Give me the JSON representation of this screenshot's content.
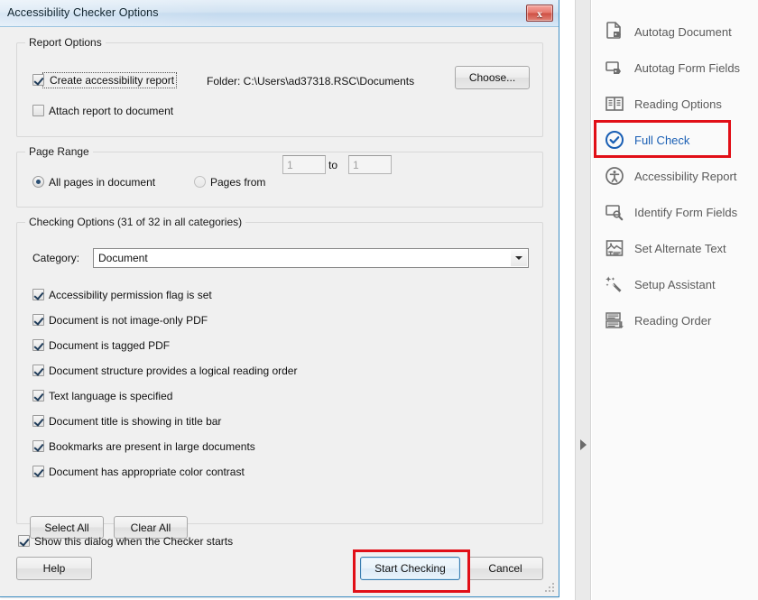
{
  "dialog": {
    "title": "Accessibility Checker Options",
    "close_label": "x",
    "report_options": {
      "legend": "Report Options",
      "create_report": {
        "label": "Create accessibility report",
        "checked": true,
        "focused": true
      },
      "folder_text": "Folder: C:\\Users\\ad37318.RSC\\Documents",
      "choose_button": "Choose...",
      "attach_report": {
        "label": "Attach report to document",
        "checked": false
      }
    },
    "page_range": {
      "legend": "Page Range",
      "all_pages": {
        "label": "All pages in document",
        "selected": true
      },
      "pages_from": {
        "label": "Pages from",
        "selected": false
      },
      "from_value": "1",
      "to_label": "to",
      "to_value": "1"
    },
    "checking_options": {
      "legend": "Checking Options (31 of 32 in all categories)",
      "category_label": "Category:",
      "category_value": "Document",
      "category_arrow": "chevron-down-icon",
      "items": [
        {
          "label": "Accessibility permission flag is set",
          "checked": true
        },
        {
          "label": "Document is not image-only PDF",
          "checked": true
        },
        {
          "label": "Document is tagged PDF",
          "checked": true
        },
        {
          "label": "Document structure provides a logical reading order",
          "checked": true
        },
        {
          "label": "Text language is specified",
          "checked": true
        },
        {
          "label": "Document title is showing in title bar",
          "checked": true
        },
        {
          "label": "Bookmarks are present in large documents",
          "checked": true
        },
        {
          "label": "Document has appropriate color contrast",
          "checked": true
        }
      ],
      "select_all_button": "Select All",
      "clear_all_button": "Clear All"
    },
    "show_dialog": {
      "label": "Show this dialog when the Checker starts",
      "checked": true
    },
    "footer": {
      "help_button": "Help",
      "start_checking_button": "Start Checking",
      "cancel_button": "Cancel"
    }
  },
  "sidebar": {
    "expand_arrow": "triangle-right-icon",
    "items": [
      {
        "label": "Autotag Document",
        "icon": "autotag-document-icon",
        "active": false
      },
      {
        "label": "Autotag Form Fields",
        "icon": "autotag-form-fields-icon",
        "active": false
      },
      {
        "label": "Reading Options",
        "icon": "reading-options-icon",
        "active": false
      },
      {
        "label": "Full Check",
        "icon": "full-check-icon",
        "active": true
      },
      {
        "label": "Accessibility Report",
        "icon": "accessibility-report-icon",
        "active": false
      },
      {
        "label": "Identify Form Fields",
        "icon": "identify-form-fields-icon",
        "active": false
      },
      {
        "label": "Set Alternate Text",
        "icon": "set-alternate-text-icon",
        "active": false
      },
      {
        "label": "Setup Assistant",
        "icon": "setup-assistant-icon",
        "active": false
      },
      {
        "label": "Reading Order",
        "icon": "reading-order-icon",
        "active": false
      }
    ]
  },
  "colors": {
    "annotation_red": "#e10f17",
    "active_blue": "#1a5fb4",
    "dialog_bg": "#f0f0f0",
    "titlebar_blue": "#c3d9ee"
  }
}
